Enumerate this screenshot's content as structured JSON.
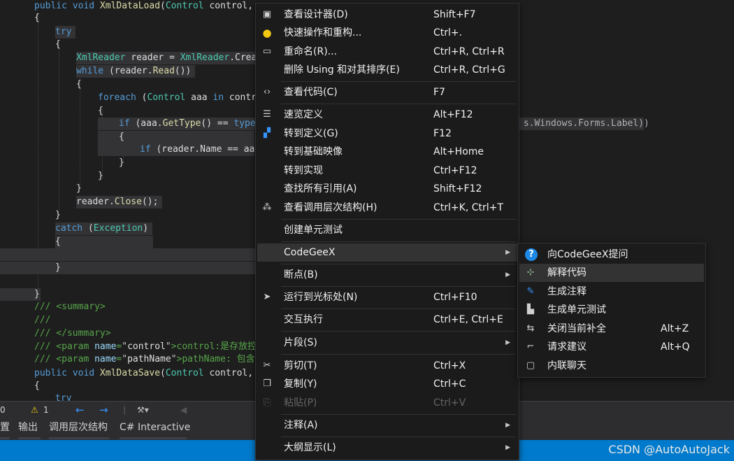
{
  "code": {
    "lines": [
      "public void XmlDataLoad(Control control, ",
      "{",
      "try",
      "{",
      "XmlReader reader = XmlReader.Crea",
      "while (reader.Read())",
      "{",
      "foreach (Control aaa in contr",
      "{",
      "if (aaa.GetType() == type",
      "{",
      "if (reader.Name == aa",
      "}",
      "}",
      "}",
      "reader.Close();",
      "}",
      "catch (Exception)",
      "{",
      "",
      "}",
      "",
      "}",
      "/// <summary>",
      "///",
      "/// </summary>",
      "/// <param name=\"control\">control:是存放控",
      "/// <param name=\"pathName\">pathName: 包含",
      "public void XmlDataSave(Control control, ",
      "{",
      "try"
    ],
    "overflow_right": "s.Windows.Forms.Label))"
  },
  "statusbar": {
    "errors": "0",
    "warnings": "1",
    "nav_back": "←",
    "nav_forward": "→"
  },
  "tooltabs": [
    "置",
    "输出",
    "调用层次结构",
    "C# Interactive"
  ],
  "watermark": "CSDN @AutoAutoJack",
  "context_menu": [
    {
      "icon": "designer-icon",
      "label": "查看设计器(D)",
      "shortcut": "Shift+F7"
    },
    {
      "icon": "lightbulb-icon",
      "label": "快速操作和重构...",
      "shortcut": "Ctrl+."
    },
    {
      "icon": "rename-icon",
      "label": "重命名(R)...",
      "shortcut": "Ctrl+R, Ctrl+R"
    },
    {
      "icon": "",
      "label": "删除 Using 和对其排序(E)",
      "shortcut": "Ctrl+R, Ctrl+G"
    },
    {
      "icon": "code-icon",
      "label": "查看代码(C)",
      "shortcut": "F7"
    },
    {
      "icon": "peek-definition-icon",
      "label": "速览定义",
      "shortcut": "Alt+F12"
    },
    {
      "icon": "goto-definition-icon",
      "label": "转到定义(G)",
      "shortcut": "F12"
    },
    {
      "icon": "",
      "label": "转到基础映像",
      "shortcut": "Alt+Home"
    },
    {
      "icon": "",
      "label": "转到实现",
      "shortcut": "Ctrl+F12"
    },
    {
      "icon": "",
      "label": "查找所有引用(A)",
      "shortcut": "Shift+F12"
    },
    {
      "icon": "call-hierarchy-icon",
      "label": "查看调用层次结构(H)",
      "shortcut": "Ctrl+K, Ctrl+T"
    },
    {
      "icon": "",
      "label": "创建单元测试",
      "shortcut": ""
    },
    {
      "icon": "",
      "label": "CodeGeeX",
      "shortcut": "",
      "submenu": true
    },
    {
      "icon": "",
      "label": "断点(B)",
      "shortcut": "",
      "submenu": true
    },
    {
      "icon": "cursor-icon",
      "label": "运行到光标处(N)",
      "shortcut": "Ctrl+F10"
    },
    {
      "icon": "",
      "label": "交互执行",
      "shortcut": "Ctrl+E, Ctrl+E"
    },
    {
      "icon": "",
      "label": "片段(S)",
      "shortcut": "",
      "submenu": true
    },
    {
      "icon": "scissors-icon",
      "label": "剪切(T)",
      "shortcut": "Ctrl+X"
    },
    {
      "icon": "copy-icon",
      "label": "复制(Y)",
      "shortcut": "Ctrl+C"
    },
    {
      "icon": "paste-icon",
      "label": "粘贴(P)",
      "shortcut": "Ctrl+V",
      "disabled": true
    },
    {
      "icon": "",
      "label": "注释(A)",
      "shortcut": "",
      "submenu": true
    },
    {
      "icon": "",
      "label": "大纲显示(L)",
      "shortcut": "",
      "submenu": true
    }
  ],
  "submenu": [
    {
      "icon": "question-icon",
      "label": "向CodeGeeX提问",
      "shortcut": ""
    },
    {
      "icon": "explain-code-icon",
      "label": "解释代码",
      "shortcut": ""
    },
    {
      "icon": "generate-comment-icon",
      "label": "生成注释",
      "shortcut": ""
    },
    {
      "icon": "unit-test-icon",
      "label": "生成单元测试",
      "shortcut": ""
    },
    {
      "icon": "toggle-completion-icon",
      "label": "关闭当前补全",
      "shortcut": "Alt+Z"
    },
    {
      "icon": "request-suggestion-icon",
      "label": "请求建议",
      "shortcut": "Alt+Q"
    },
    {
      "icon": "inline-chat-icon",
      "label": "内联聊天",
      "shortcut": ""
    }
  ],
  "colors": {
    "editor_bg": "#1e1e1e",
    "menu_bg": "#1b1b1c",
    "menu_selected": "#333334",
    "accent_blue": "#007acc",
    "keyword": "#569cd6",
    "type": "#4ec9b0",
    "comment": "#57a64a"
  }
}
